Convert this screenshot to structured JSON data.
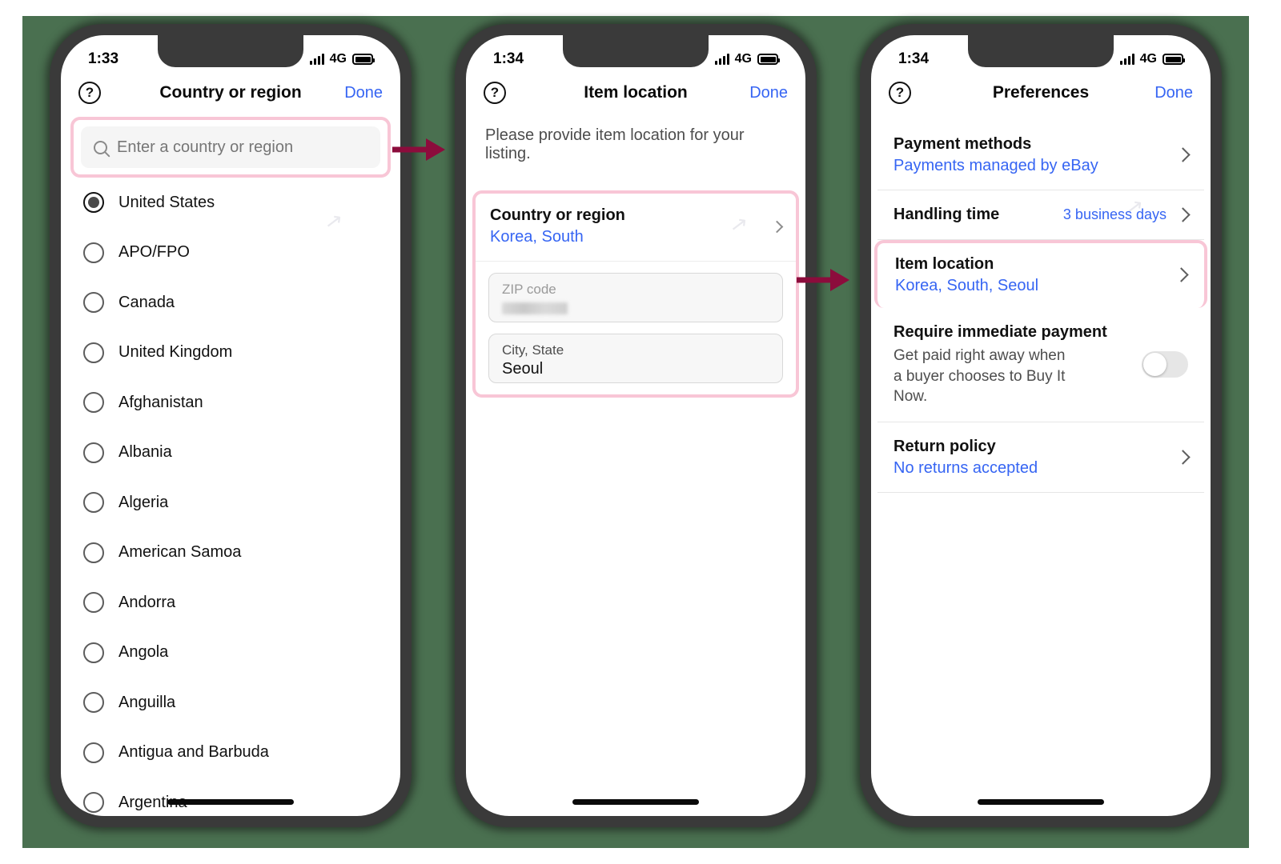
{
  "background_color": "#4a7050",
  "accent_highlight_color": "#f8c6d6",
  "arrow_color": "#8c0c3c",
  "link_color": "#3665f3",
  "phone1": {
    "status": {
      "time": "1:33",
      "network": "4G",
      "signal_icon": "signal-bars-icon",
      "battery_icon": "battery-icon"
    },
    "nav": {
      "help_icon": "?",
      "title": "Country or region",
      "done_label": "Done"
    },
    "search": {
      "icon": "search-icon",
      "placeholder": "Enter a country or region",
      "value": ""
    },
    "countries": [
      {
        "label": "United States",
        "selected": true
      },
      {
        "label": "APO/FPO",
        "selected": false
      },
      {
        "label": "Canada",
        "selected": false
      },
      {
        "label": "United Kingdom",
        "selected": false
      },
      {
        "label": "Afghanistan",
        "selected": false
      },
      {
        "label": "Albania",
        "selected": false
      },
      {
        "label": "Algeria",
        "selected": false
      },
      {
        "label": "American Samoa",
        "selected": false
      },
      {
        "label": "Andorra",
        "selected": false
      },
      {
        "label": "Angola",
        "selected": false
      },
      {
        "label": "Anguilla",
        "selected": false
      },
      {
        "label": "Antigua and Barbuda",
        "selected": false
      },
      {
        "label": "Argentina",
        "selected": false
      }
    ]
  },
  "phone2": {
    "status": {
      "time": "1:34",
      "network": "4G"
    },
    "nav": {
      "help_icon": "?",
      "title": "Item location",
      "done_label": "Done"
    },
    "intro": "Please provide item location for your listing.",
    "country_row": {
      "label": "Country or region",
      "value": "Korea, South",
      "chevron": "chevron-right-icon"
    },
    "zip_field": {
      "label": "ZIP code",
      "value": "",
      "redacted": true
    },
    "city_field": {
      "label": "City, State",
      "value": "Seoul"
    }
  },
  "phone3": {
    "status": {
      "time": "1:34",
      "network": "4G"
    },
    "nav": {
      "help_icon": "?",
      "title": "Preferences",
      "done_label": "Done"
    },
    "rows": [
      {
        "title": "Payment methods",
        "sub_link": "Payments managed by eBay",
        "chevron": true
      },
      {
        "title": "Handling time",
        "right_value": "3 business days",
        "chevron": true
      },
      {
        "title": "Item location",
        "sub_link": "Korea, South, Seoul",
        "chevron": true,
        "highlighted": true
      },
      {
        "title": "Require immediate payment",
        "sub": "Get paid right away when a buyer chooses to Buy It Now.",
        "toggle": "off"
      },
      {
        "title": "Return policy",
        "sub_link": "No returns accepted",
        "chevron": true
      }
    ]
  }
}
